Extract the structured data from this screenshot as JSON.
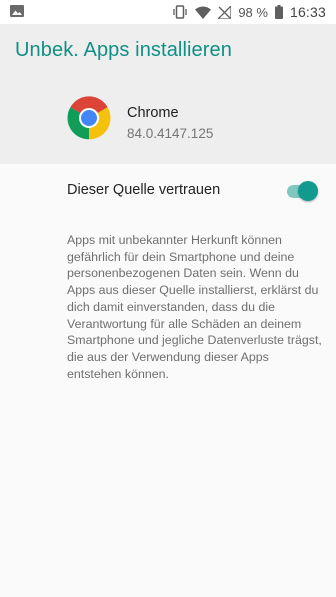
{
  "status_bar": {
    "battery_percent": "98 %",
    "time": "16:33",
    "left_icon": "image-icon",
    "right_icons": [
      "vibrate-icon",
      "wifi-icon",
      "no-signal-icon",
      "battery-icon"
    ]
  },
  "header": {
    "title": "Unbek. Apps installieren",
    "title_color": "#118f86",
    "app": {
      "name": "Chrome",
      "version": "84.0.4147.125",
      "icon": "chrome-logo"
    }
  },
  "trust_setting": {
    "label": "Dieser Quelle vertrauen",
    "enabled": true,
    "accent_color": "#129a8f"
  },
  "warning_text": "Apps mit unbekannter Herkunft können gefährlich für dein Smartphone und deine personenbezogenen Daten sein. Wenn du Apps aus dieser Quelle installierst, erklärst du dich damit einverstanden, dass du die Verantwortung für alle Schäden an deinem Smartphone und jegliche Datenverluste trägst, die aus der Verwendung dieser Apps entstehen können."
}
